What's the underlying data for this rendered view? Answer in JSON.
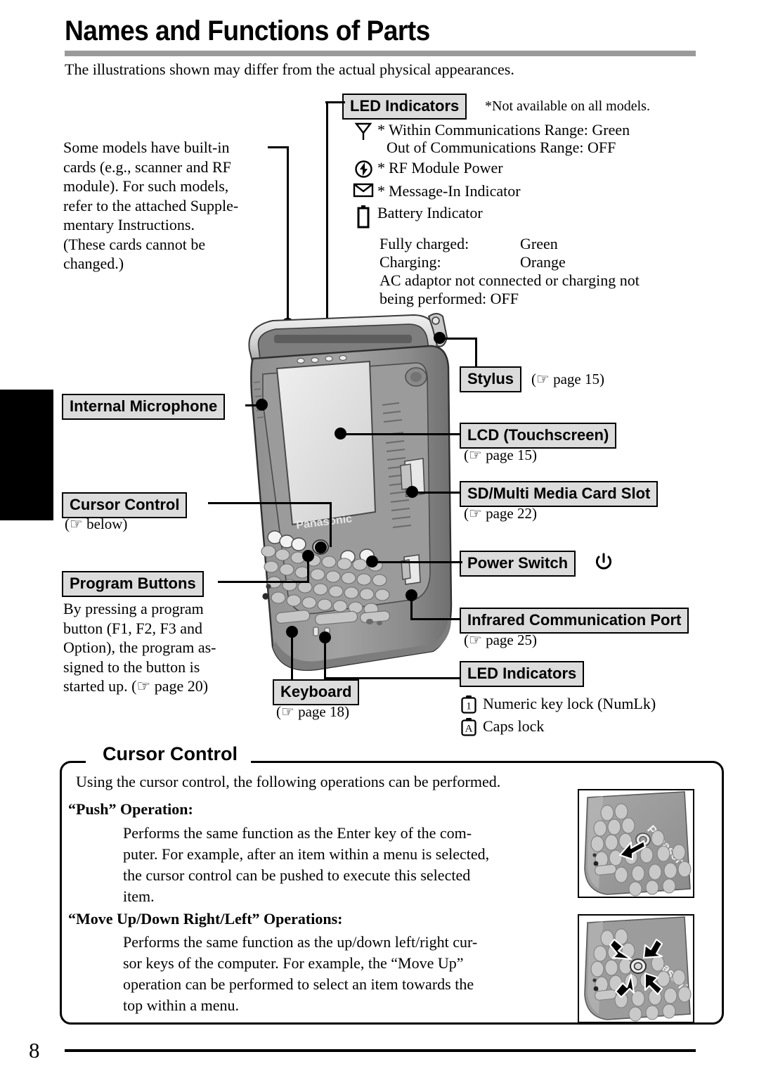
{
  "header": {
    "title": "Names and Functions of Parts",
    "intro": "The illustrations shown may differ from the actual physical appearances."
  },
  "left_note": {
    "lines": [
      "Some models have built-in",
      "cards (e.g., scanner and RF",
      "module). For such models,",
      "refer to the attached Supple-",
      "mentary  Instructions.",
      "(These  cards  cannot  be",
      "changed.)"
    ]
  },
  "led_top": {
    "label": "LED Indicators",
    "footnote": "*Not available on all models.",
    "rows": [
      {
        "icon": "antenna-icon",
        "star": "*",
        "line1": "Within Communications Range:  Green",
        "line2": "Out of Communications Range: OFF"
      },
      {
        "icon": "rf-power-icon",
        "star": "*",
        "line1": "RF Module Power",
        "line2": ""
      },
      {
        "icon": "envelope-icon",
        "star": "*",
        "line1": "Message-In Indicator",
        "line2": ""
      },
      {
        "icon": "battery-icon",
        "star": "",
        "line1": "Battery Indicator",
        "line2": ""
      }
    ],
    "battery_detail": [
      {
        "label": "Fully charged:",
        "value": "Green"
      },
      {
        "label": "Charging:",
        "value": "Orange"
      }
    ],
    "battery_off_line1": "AC adaptor not connected or charging not",
    "battery_off_line2": "being performed:  OFF"
  },
  "callouts": {
    "internal_microphone": {
      "label": "Internal Microphone"
    },
    "cursor_control": {
      "label": "Cursor Control",
      "ref": "(☞ below)"
    },
    "program_buttons": {
      "label": "Program Buttons",
      "lines": [
        "By pressing a program",
        "button (F1, F2, F3 and",
        "Option), the program as-",
        "signed to the button is",
        "started up.  (☞ page 20)"
      ]
    },
    "keyboard": {
      "label": "Keyboard",
      "ref": "(☞ page 18)"
    },
    "stylus": {
      "label": "Stylus",
      "ref": "(☞ page 15)"
    },
    "lcd": {
      "label": "LCD (Touchscreen)",
      "ref": "(☞ page 15)"
    },
    "sd_slot": {
      "label": "SD/Multi Media Card Slot",
      "ref": "(☞ page 22)"
    },
    "power_switch": {
      "label": "Power Switch",
      "icon": "power-icon"
    },
    "infrared": {
      "label": "Infrared Communication Port",
      "ref": "(☞ page 25)"
    },
    "led_bottom": {
      "label": "LED Indicators",
      "items": [
        {
          "key": "1",
          "text": "Numeric key lock (NumLk)"
        },
        {
          "key": "A",
          "text": "Caps lock"
        }
      ]
    }
  },
  "cursor_section": {
    "title": "Cursor Control",
    "intro": "Using the cursor control, the following operations can be performed.",
    "push": {
      "heading": "“Push” Operation:",
      "lines": [
        "Performs the same function as the Enter key of the com-",
        "puter. For example, after an item within a menu is selected,",
        "the cursor control can be pushed to execute this selected",
        "item."
      ]
    },
    "move": {
      "heading": "“Move Up/Down Right/Left” Operations:",
      "lines": [
        "Performs the same function as the up/down left/right cur-",
        "sor keys of the computer. For example, the “Move Up”",
        "operation can be performed to select an item towards the",
        "top within a menu."
      ]
    }
  },
  "device": {
    "brand": "Panasonic"
  },
  "footer": {
    "page_number": "8"
  },
  "colors": {
    "rule": "#9a9a9a",
    "callout_fill": "#dcdcdc",
    "ink": "#000000",
    "device_body": "#8e8e8e",
    "device_light": "#b8b8b8",
    "device_screen": "#dcdcdc"
  }
}
